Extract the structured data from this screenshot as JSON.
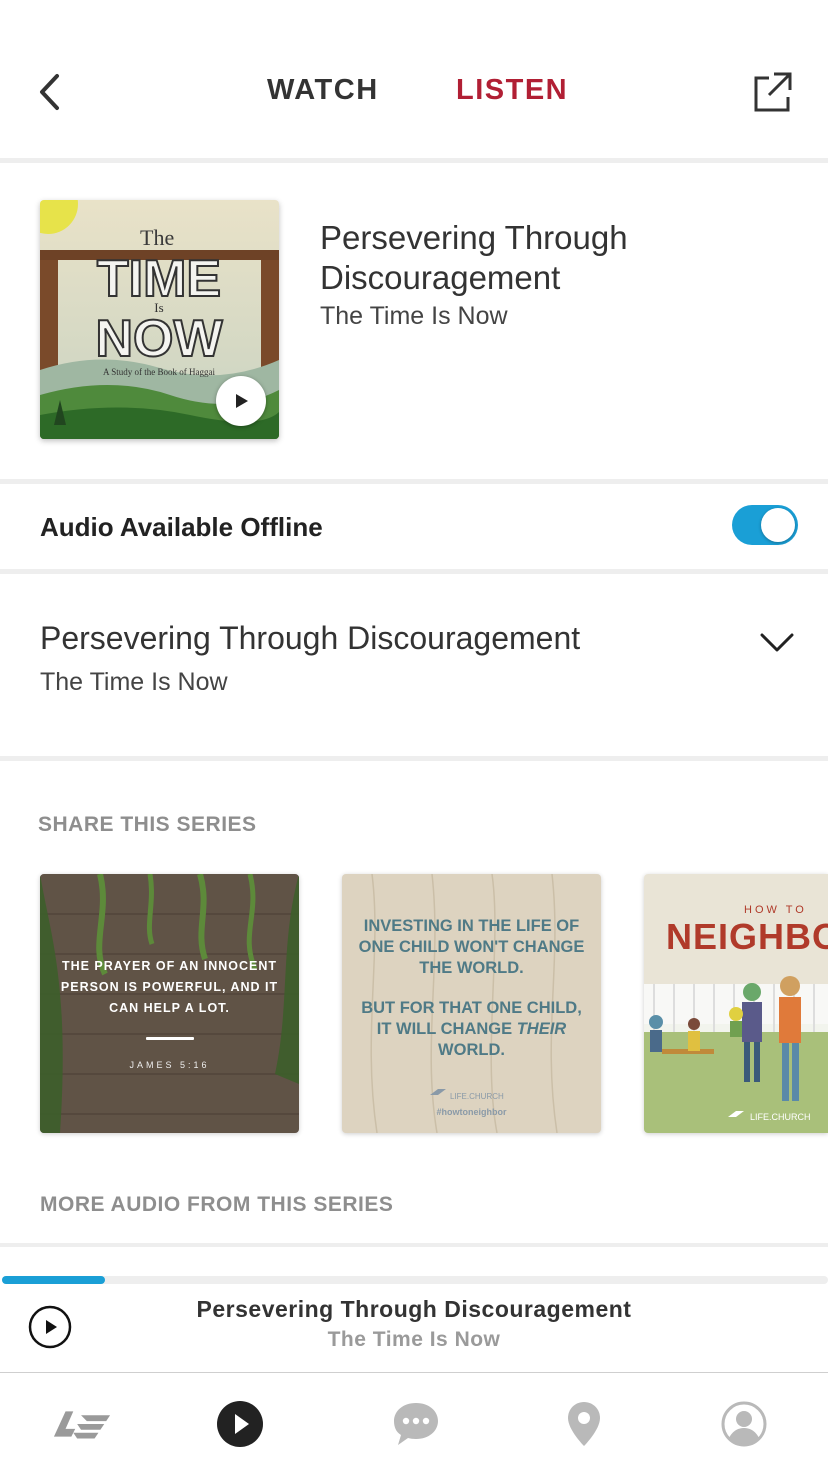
{
  "header": {
    "tabs": [
      {
        "label": "WATCH",
        "active": false
      },
      {
        "label": "LISTEN",
        "active": true
      }
    ],
    "back_icon": "chevron-left-icon",
    "share_icon": "external-share-icon"
  },
  "hero": {
    "title": "Persevering Through Discouragement",
    "series": "The Time Is Now",
    "artwork": {
      "small_text": "The",
      "big_line1": "TIME",
      "is_text": "Is",
      "big_line2": "NOW",
      "caption": "A Study of the Book of Haggai"
    }
  },
  "offline": {
    "label": "Audio Available Offline",
    "enabled": true
  },
  "message": {
    "title": "Persevering Through Discouragement",
    "series": "The Time Is Now"
  },
  "share_section": {
    "label": "SHARE THIS SERIES",
    "cards": [
      {
        "quote": "THE PRAYER OF AN INNOCENT PERSON IS POWERFUL, AND IT CAN HELP A LOT.",
        "reference": "JAMES 5:16"
      },
      {
        "line1": "INVESTING IN THE LIFE OF ONE CHILD WON'T CHANGE THE WORLD.",
        "line2a": "BUT FOR THAT ONE CHILD,",
        "line2b": "IT WILL CHANGE",
        "line2c": "THEIR",
        "line2d": "WORLD.",
        "brand": "LIFE.CHURCH",
        "hashtag": "#howtoneighbor"
      },
      {
        "small": "HOW TO",
        "big": "NEIGHBO",
        "brand": "LIFE.CHURCH"
      }
    ]
  },
  "more_audio": {
    "label": "MORE AUDIO FROM THIS SERIES"
  },
  "player": {
    "title": "Persevering Through Discouragement",
    "series": "The Time Is Now",
    "progress": 0.125
  },
  "nav": {
    "items": [
      {
        "icon": "lifechurch-logo-icon"
      },
      {
        "icon": "play-circle-icon"
      },
      {
        "icon": "chat-bubble-icon"
      },
      {
        "icon": "location-pin-icon"
      },
      {
        "icon": "profile-icon"
      }
    ]
  },
  "colors": {
    "accent_red": "#b11f34",
    "accent_blue": "#1a9fd6"
  }
}
